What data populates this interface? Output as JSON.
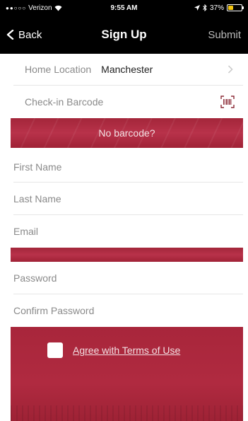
{
  "status_bar": {
    "carrier": "Verizon",
    "signal": "●●○○○",
    "time": "9:55 AM",
    "battery_text": "37%",
    "battery_level": 0.37,
    "battery_color": "#f1c40f"
  },
  "nav": {
    "back_label": "Back",
    "title": "Sign Up",
    "submit_label": "Submit"
  },
  "home_location": {
    "label": "Home Location",
    "value": "Manchester"
  },
  "barcode": {
    "label": "Check-in Barcode",
    "no_barcode_label": "No barcode?"
  },
  "fields": {
    "first_name_placeholder": "First Name",
    "last_name_placeholder": "Last Name",
    "email_placeholder": "Email",
    "password_placeholder": "Password",
    "confirm_password_placeholder": "Confirm Password"
  },
  "terms": {
    "label": "Agree with Terms of Use",
    "checked": false
  },
  "colors": {
    "accent_red": "#a8263b",
    "nav_background": "#000000"
  }
}
